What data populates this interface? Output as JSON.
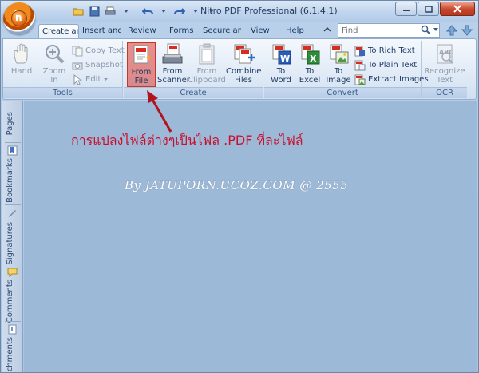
{
  "window": {
    "title": "Nitro PDF Professional (6.1.4.1)",
    "orb_glyph": "n"
  },
  "tabs": [
    {
      "label": "Create and Edit",
      "active": true
    },
    {
      "label": "Insert and"
    },
    {
      "label": "Review"
    },
    {
      "label": "Forms"
    },
    {
      "label": "Secure and"
    },
    {
      "label": "View"
    },
    {
      "label": "Help"
    }
  ],
  "find": {
    "placeholder": "Find"
  },
  "groups": {
    "tools": {
      "label": "Tools",
      "hand": "Hand",
      "zoom_line1": "Zoom",
      "zoom_line2": "In",
      "copy_text": "Copy Text",
      "snapshot": "Snapshot",
      "edit": "Edit"
    },
    "create": {
      "label": "Create",
      "from_file_1": "From",
      "from_file_2": "File",
      "from_scanner_1": "From",
      "from_scanner_2": "Scanner",
      "from_clipboard_1": "From",
      "from_clipboard_2": "Clipboard",
      "combine_1": "Combine",
      "combine_2": "Files"
    },
    "convert": {
      "label": "Convert",
      "to_word_1": "To",
      "to_word_2": "Word",
      "to_excel_1": "To",
      "to_excel_2": "Excel",
      "to_image_1": "To",
      "to_image_2": "Image",
      "to_rich_text": "To Rich Text",
      "to_plain_text": "To Plain Text",
      "extract_images": "Extract Images"
    },
    "ocr": {
      "label": "OCR",
      "recognize_1": "Recognize",
      "recognize_2": "Text"
    }
  },
  "side_tabs": {
    "pages": "Pages",
    "bookmarks": "Bookmarks",
    "signatures": "Signatures",
    "comments": "Comments",
    "attachments": "chments"
  },
  "annotation": "การแปลงไฟล์ต่างๆเป็นไฟล .PDF ที่ละไฟล์",
  "watermark": "By JATUPORN.UCOZ.COM @ 2555",
  "colors": {
    "annotation_red": "#c8102e",
    "canvas_blue": "#9db9d8",
    "highlight": "#dc3c32"
  }
}
